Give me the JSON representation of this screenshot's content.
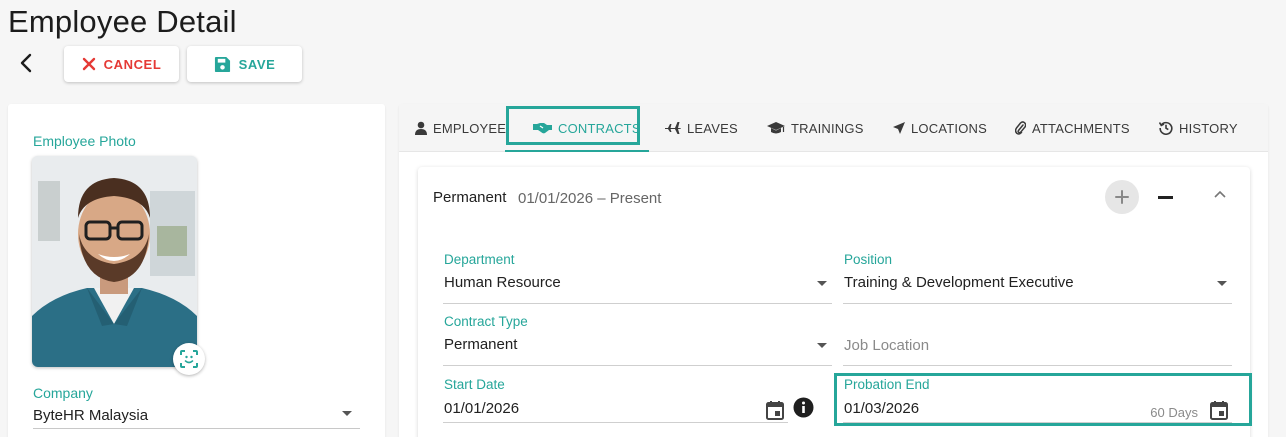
{
  "page": {
    "title": "Employee Detail"
  },
  "toolbar": {
    "cancel_label": "CANCEL",
    "save_label": "SAVE"
  },
  "colors": {
    "accent": "#26a69a",
    "cancel": "#e53935"
  },
  "left_panel": {
    "photo_label": "Employee Photo",
    "company_label": "Company",
    "company_value": "ByteHR Malaysia"
  },
  "tabs": [
    {
      "label": "EMPLOYEE",
      "icon": "person-icon"
    },
    {
      "label": "CONTRACTS",
      "icon": "handshake-icon",
      "active": true
    },
    {
      "label": "LEAVES",
      "icon": "airplane-icon"
    },
    {
      "label": "TRAININGS",
      "icon": "graduation-cap-icon"
    },
    {
      "label": "LOCATIONS",
      "icon": "location-arrow-icon"
    },
    {
      "label": "ATTACHMENTS",
      "icon": "paperclip-icon"
    },
    {
      "label": "HISTORY",
      "icon": "history-icon"
    }
  ],
  "contract": {
    "type": "Permanent",
    "date_range": "01/01/2026 – Present",
    "fields": {
      "department": {
        "label": "Department",
        "value": "Human Resource"
      },
      "position": {
        "label": "Position",
        "value": "Training & Development Executive"
      },
      "contract_type": {
        "label": "Contract Type",
        "value": "Permanent"
      },
      "job_location": {
        "placeholder": "Job Location"
      },
      "start_date": {
        "label": "Start Date",
        "value": "01/01/2026"
      },
      "probation_end": {
        "label": "Probation End",
        "value": "01/03/2026",
        "hint": "60 Days"
      }
    }
  }
}
